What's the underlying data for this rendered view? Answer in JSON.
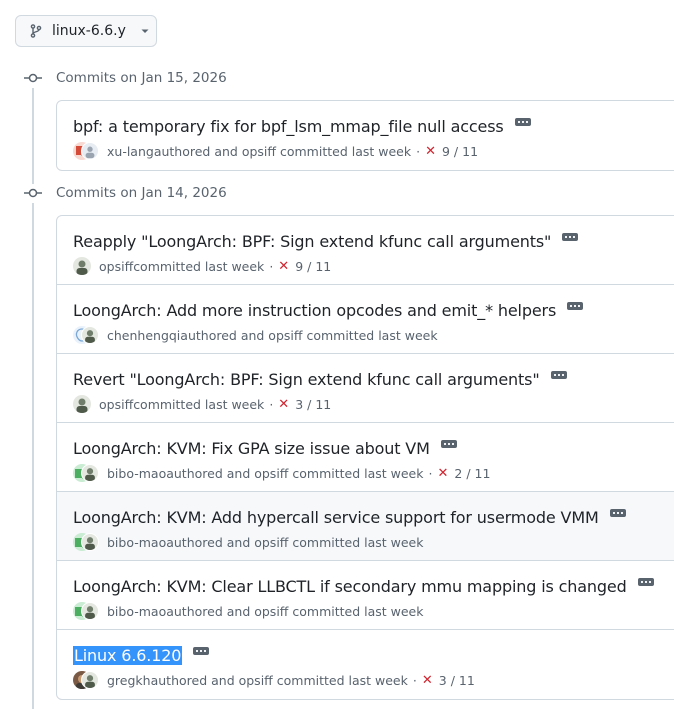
{
  "branch": {
    "name": "linux-6.6.y"
  },
  "groups": [
    {
      "header": "Commits on Jan 15, 2026",
      "commits": [
        {
          "message": "bpf: a temporary fix for bpf_lsm_mmap_file null access",
          "author": "xu-lang",
          "meta": " authored and opsiff committed last week",
          "status": "9 / 11",
          "has_status": true
        }
      ]
    },
    {
      "header": "Commits on Jan 14, 2026",
      "commits": [
        {
          "message": "Reapply \"LoongArch: BPF: Sign extend kfunc call arguments\"",
          "author": "opsiff",
          "meta": " committed last week",
          "status": "9 / 11",
          "has_status": true
        },
        {
          "message": "LoongArch: Add more instruction opcodes and emit_* helpers",
          "author": "chenhengqi",
          "meta": " authored and opsiff committed last week",
          "status": "",
          "has_status": false
        },
        {
          "message": "Revert \"LoongArch: BPF: Sign extend kfunc call arguments\"",
          "author": "opsiff",
          "meta": " committed last week",
          "status": "3 / 11",
          "has_status": true
        },
        {
          "message": "LoongArch: KVM: Fix GPA size issue about VM",
          "author": "bibo-mao",
          "meta": " authored and opsiff committed last week",
          "status": "2 / 11",
          "has_status": true
        },
        {
          "message": "LoongArch: KVM: Add hypercall service support for usermode VMM",
          "author": "bibo-mao",
          "meta": " authored and opsiff committed last week",
          "status": "",
          "has_status": false
        },
        {
          "message": "LoongArch: KVM: Clear LLBCTL if secondary mmu mapping is changed",
          "author": "bibo-mao",
          "meta": " authored and opsiff committed last week",
          "status": "",
          "has_status": false
        },
        {
          "message": "Linux 6.6.120",
          "author": "gregkh",
          "meta": " authored and opsiff committed last week",
          "status": "3 / 11",
          "has_status": true
        }
      ]
    }
  ],
  "colors": {
    "border": "#d1d9e0",
    "muted": "#59636e",
    "fail": "#d1242f",
    "selection": "#3593fc"
  }
}
